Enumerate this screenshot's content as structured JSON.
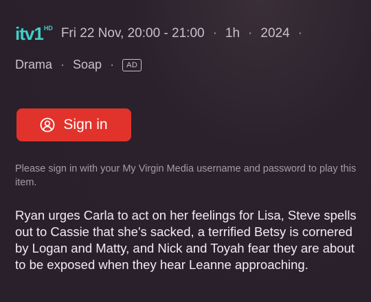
{
  "programme": {
    "channel": {
      "name": "itv1",
      "hd_badge": "HD",
      "brand_color": "#3fd0c8"
    },
    "schedule": "Fri 22 Nov, 20:00 - 21:00",
    "duration": "1h",
    "year": "2024",
    "genres": [
      "Drama",
      "Soap"
    ],
    "accessibility_badge": "AD"
  },
  "signin": {
    "label": "Sign in",
    "icon": "user-circle-icon",
    "color": "#e1332b"
  },
  "hint": "Please sign in with your My Virgin Media username and password to play this item.",
  "synopsis": "Ryan urges Carla to act on her feelings for Lisa, Steve spells out to Cassie that she's sacked, a terrified Betsy is cornered by Logan and Matty, and Nick and Toyah fear they are about to be exposed when they hear Leanne approaching."
}
